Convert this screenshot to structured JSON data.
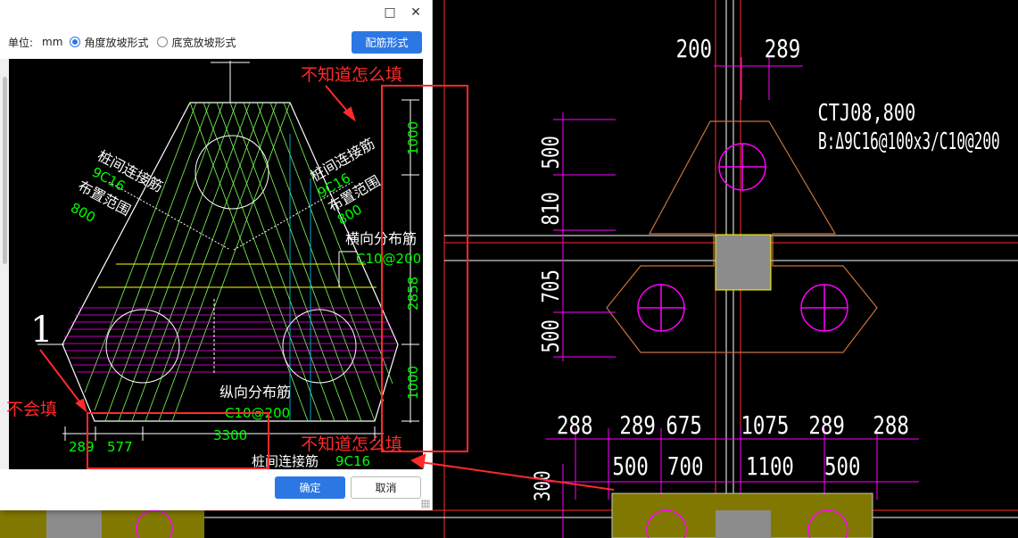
{
  "cad_left": {
    "labels": [
      "289",
      "577",
      "3300",
      "1000",
      "2858",
      "1000",
      "1",
      "C10@200",
      "C10@200",
      "9C16",
      "800",
      "9C16",
      "800"
    ],
    "zh": {
      "pile_link_left": "桩间连接筋",
      "pile_link_right": "桩间连接筋",
      "range_left": "布置范围",
      "range_right": "布置范围",
      "horiz_dist": "横向分布筋",
      "long_dist": "纵向分布筋",
      "bottom_link": "桩间连接筋"
    },
    "bottom_link_value": "9C16"
  },
  "annotations": {
    "dont_know_top": "不知道怎么填",
    "dont_know_bottom": "不知道怎么填",
    "cant_fill": "不会填"
  },
  "dialog": {
    "unit_label": "单位:",
    "unit_value": "mm",
    "radio_angle": "角度放坡形式",
    "radio_bottom": "底宽放坡形式",
    "rebar_button": "配筋形式",
    "ok": "确定",
    "cancel": "取消",
    "maximize_icon": "□",
    "close_icon": "✕"
  },
  "cad_right": {
    "top_dims": [
      "200",
      "289"
    ],
    "title1": "CTJ08,800",
    "title2": "B:Δ9C16@100x3/C10@200",
    "left_dims": [
      "500",
      "810",
      "705",
      "500"
    ],
    "row1_dims": [
      "288",
      "289",
      "675",
      "1075",
      "289",
      "288"
    ],
    "row2_dims": [
      "500",
      "700",
      "1100",
      "500"
    ],
    "left_dim_bottom": "300"
  },
  "colors": {
    "accent": "#2b78e4",
    "annotation_red": "#ff2a2a",
    "cad_green": "#00ff00",
    "cad_magenta": "#ff00ff",
    "cad_yellow": "#ffff00"
  }
}
